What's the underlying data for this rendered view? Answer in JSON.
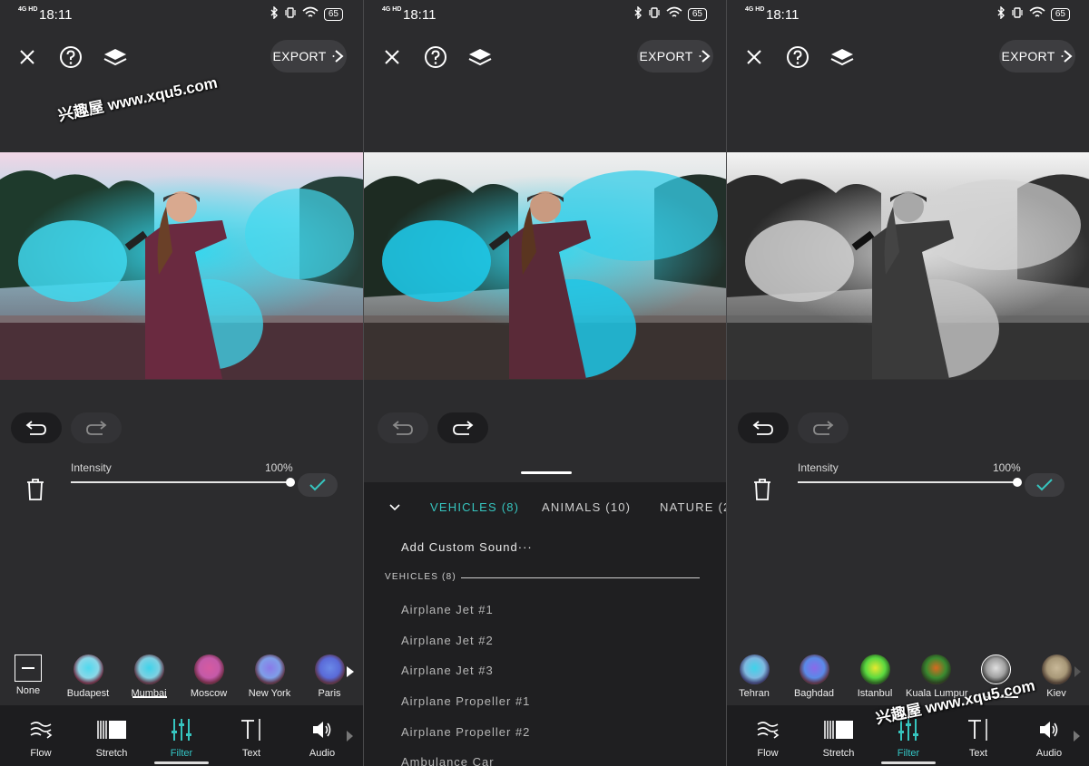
{
  "status": {
    "network": "4G HD",
    "time": "18:11",
    "battery": "65"
  },
  "export_label": "EXPORT",
  "watermark": "兴趣屋 www.xqu5.com",
  "intensity": {
    "label": "Intensity",
    "value": "100%",
    "level": 1.0
  },
  "filters_left": [
    "None",
    "Budapest",
    "Mumbai",
    "Moscow",
    "New York",
    "Paris"
  ],
  "filters_right": [
    "Tehran",
    "Baghdad",
    "Istanbul",
    "Kuala Lumpur",
    "",
    "Kiev"
  ],
  "selected_filter_left": "Mumbai",
  "tools": [
    "Flow",
    "Stretch",
    "Filter",
    "Text",
    "Audio"
  ],
  "active_tool": "Filter",
  "sounds": {
    "tabs": [
      "VEHICLES (8)",
      "ANIMALS (10)",
      "NATURE (2"
    ],
    "active_tab": "VEHICLES (8)",
    "add_custom": "Add Custom Sound···",
    "section_header": "VEHICLES (8)",
    "items": [
      "Airplane Jet #1",
      "Airplane Jet #2",
      "Airplane Jet #3",
      "Airplane Propeller #1",
      "Airplane Propeller #2",
      "Ambulance Car"
    ]
  },
  "colors": {
    "accent": "#36c5bf",
    "background": "#2c2c2e",
    "toolbar": "#1d1d1f"
  },
  "icons": [
    "close-icon",
    "help-icon",
    "layers-icon",
    "undo-icon",
    "redo-icon",
    "trash-icon",
    "check-icon",
    "flow-icon",
    "stretch-icon",
    "filter-icon",
    "text-icon",
    "audio-icon"
  ]
}
